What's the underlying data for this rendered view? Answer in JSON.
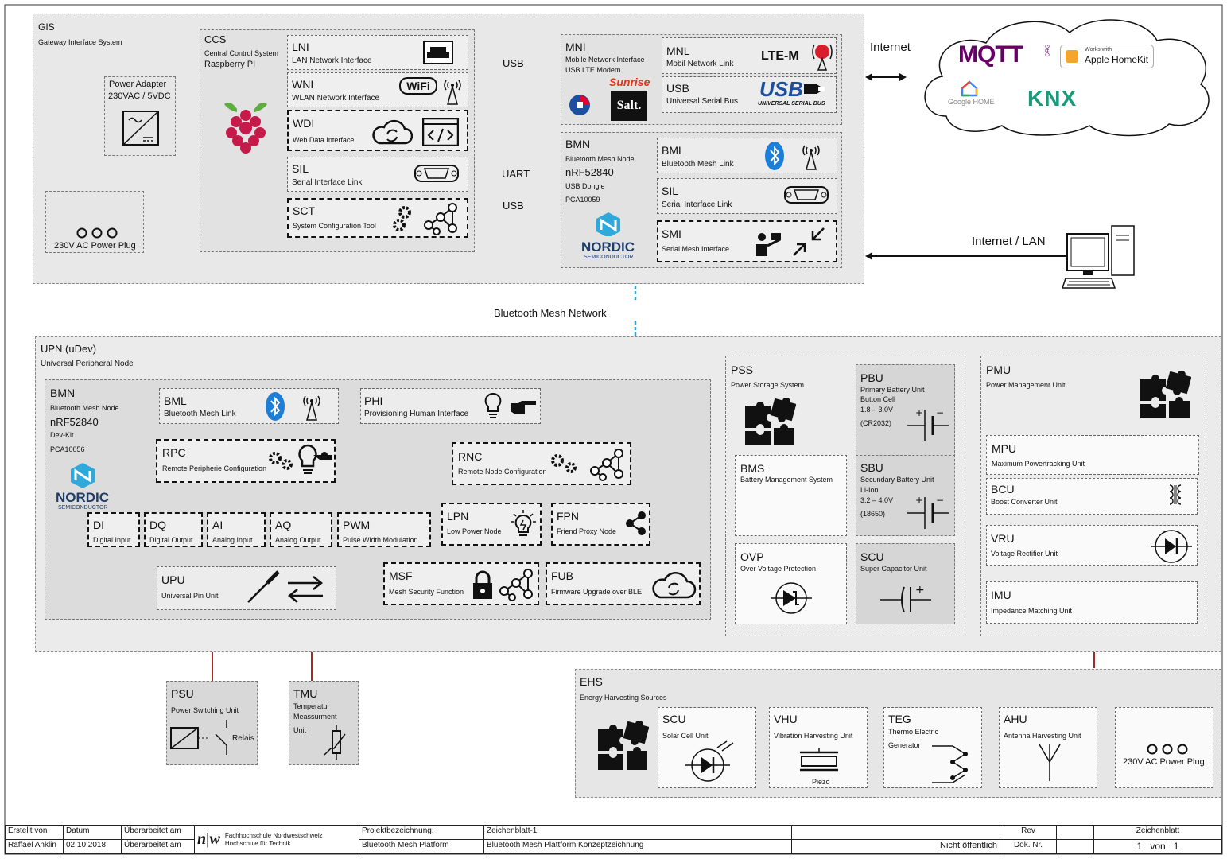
{
  "gis": {
    "code": "GIS",
    "name": "Gateway Interface System",
    "power_adapter": {
      "title": "Power Adapter",
      "spec": "230VAC / 5VDC"
    },
    "power_plug": "230V AC Power Plug",
    "ccs": {
      "code": "CCS",
      "name": "Central Control System",
      "sub": "Raspberry PI"
    },
    "lni": {
      "code": "LNI",
      "name": "LAN Network Interface"
    },
    "wni": {
      "code": "WNI",
      "name": "WLAN Network Interface",
      "wifi": "WiFi"
    },
    "wdi": {
      "code": "WDI",
      "name": "Web Data Interface"
    },
    "sil": {
      "code": "SIL",
      "name": "Serial Interface Link"
    },
    "sct": {
      "code": "SCT",
      "name": "System Configuration Tool"
    },
    "link_usb1": "USB",
    "link_uart": "UART",
    "link_usb2": "USB",
    "mni": {
      "code": "MNI",
      "name": "Mobile Network Interface",
      "sub": "USB LTE Modem",
      "brand1": "Sunrise",
      "brand2": "Salt."
    },
    "mnl": {
      "code": "MNL",
      "name": "Mobil Network Link",
      "logo": "LTE-M"
    },
    "usb": {
      "code": "USB",
      "name": "Universal Serial Bus",
      "logo": "USB",
      "logo_sub": "UNIVERSAL SERIAL BUS"
    },
    "bmn": {
      "code": "BMN",
      "name": "Bluetooth Mesh Node",
      "chip": "nRF52840",
      "board": "USB Dongle",
      "pca": "PCA10059",
      "brand": "NORDIC",
      "brand_sub": "SEMICONDUCTOR"
    },
    "bml": {
      "code": "BML",
      "name": "Bluetooth Mesh Link"
    },
    "sil2": {
      "code": "SIL",
      "name": "Serial Interface Link"
    },
    "smi": {
      "code": "SMI",
      "name": "Serial Mesh Interface"
    }
  },
  "internet": {
    "label": "Internet",
    "mqtt": "MQTT",
    "mqtt_sub": "ORG",
    "homekit_small": "Works with",
    "homekit": "Apple HomeKit",
    "google": "Google HOME",
    "knx": "KNX"
  },
  "internet_lan": "Internet / LAN",
  "mesh_network": "Bluetooth Mesh Network",
  "upn": {
    "code": "UPN (uDev)",
    "name": "Universal Peripheral Node",
    "bmn": {
      "code": "BMN",
      "name": "Bluetooth Mesh Node",
      "chip": "nRF52840",
      "board": "Dev-Kit",
      "pca": "PCA10056",
      "brand": "NORDIC",
      "brand_sub": "SEMICONDUCTOR"
    },
    "bml": {
      "code": "BML",
      "name": "Bluetooth Mesh Link"
    },
    "phi": {
      "code": "PHI",
      "name": "Provisioning Human Interface"
    },
    "rpc": {
      "code": "RPC",
      "name": "Remote Peripherie Configuration"
    },
    "rnc": {
      "code": "RNC",
      "name": "Remote Node Configuration"
    },
    "di": {
      "code": "DI",
      "name": "Digital Input"
    },
    "dq": {
      "code": "DQ",
      "name": "Digital Output"
    },
    "ai": {
      "code": "AI",
      "name": "Analog Input"
    },
    "aq": {
      "code": "AQ",
      "name": "Analog Output"
    },
    "pwm": {
      "code": "PWM",
      "name": "Pulse Width Modulation"
    },
    "lpn": {
      "code": "LPN",
      "name": "Low Power Node"
    },
    "fpn": {
      "code": "FPN",
      "name": "Friend Proxy Node"
    },
    "upu": {
      "code": "UPU",
      "name": "Universal Pin Unit"
    },
    "msf": {
      "code": "MSF",
      "name": "Mesh Security Function"
    },
    "fub": {
      "code": "FUB",
      "name": "Firmware Upgrade over BLE"
    }
  },
  "pss": {
    "code": "PSS",
    "name": "Power Storage System",
    "pbu": {
      "code": "PBU",
      "l1": "Primary Battery Unit",
      "l2": "Button Cell",
      "l3": "1.8 – 3.0V",
      "l4": "(CR2032)"
    },
    "bms": {
      "code": "BMS",
      "name": "Battery Management System"
    },
    "sbu": {
      "code": "SBU",
      "l1": "Secundary Battery Unit",
      "l2": "Li-Ion",
      "l3": "3.2 – 4.0V",
      "l4": "(18650)"
    },
    "ovp": {
      "code": "OVP",
      "name": "Over Voltage Protection"
    },
    "scu": {
      "code": "SCU",
      "name": "Super Capacitor Unit"
    }
  },
  "pmu": {
    "code": "PMU",
    "name": "Power Managemenr Unit",
    "mpu": {
      "code": "MPU",
      "name": "Maximum Powertracking Unit"
    },
    "bcu": {
      "code": "BCU",
      "name": "Boost Converter Unit"
    },
    "vru": {
      "code": "VRU",
      "name": "Voltage Rectifier Unit"
    },
    "imu": {
      "code": "IMU",
      "name": "Impedance Matching Unit"
    }
  },
  "psu": {
    "code": "PSU",
    "name": "Power Switching Unit",
    "relais": "Relais"
  },
  "tmu": {
    "code": "TMU",
    "l1": "Temperatur",
    "l2": "Meassurment",
    "l3": "Unit"
  },
  "ehs": {
    "code": "EHS",
    "name": "Energy Harvesting Sources",
    "scu": {
      "code": "SCU",
      "name": "Solar Cell Unit"
    },
    "vhu": {
      "code": "VHU",
      "name": "Vibration Harvesting Unit",
      "piezo": "Piezo"
    },
    "teg": {
      "code": "TEG",
      "l1": "Thermo Electric",
      "l2": "Generator"
    },
    "ahu": {
      "code": "AHU",
      "name": "Antenna Harvesting Unit"
    },
    "plug": "230V AC Power Plug"
  },
  "title_block": {
    "erstellt_von_label": "Erstellt von",
    "erstellt_von": "Raffael Anklin",
    "datum_label": "Datum",
    "datum": "02.10.2018",
    "ueberarbeitet1": "Überarbeitet am",
    "ueberarbeitet2": "Überarbeitet am",
    "logo": "n|w",
    "school1": "Fachhochschule Nordwestschweiz",
    "school2": "Hochschule für Technik",
    "projekt_label": "Projektbezeichnung:",
    "projekt": "Bluetooth Mesh Platform",
    "zeichenblatt_label": "Zeichenblatt-1",
    "zeichnung": "Bluetooth Mesh Plattform Konzeptzeichnung",
    "access": "Nicht öffentlich",
    "rev_label": "Rev",
    "dok_label": "Dok. Nr.",
    "blatt_label": "Zeichenblatt",
    "blatt_num": "1",
    "von": "von",
    "blatt_total": "1"
  }
}
